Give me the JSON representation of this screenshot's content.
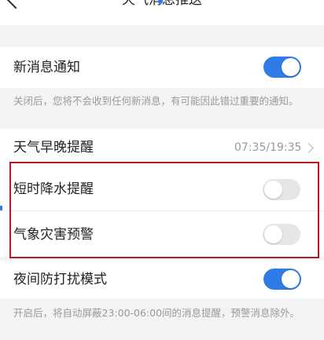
{
  "header": {
    "title": "天气消息推送"
  },
  "settings": {
    "new_message": {
      "label": "新消息通知",
      "enabled": true,
      "description": "关闭后，您将不会收到任何新消息，有可能因此错过重要的通知。"
    },
    "morning_evening": {
      "label": "天气早晚提醒",
      "value": "07:35/19:35"
    },
    "short_rain": {
      "label": "短时降水提醒",
      "enabled": false
    },
    "disaster_warning": {
      "label": "气象灾害预警",
      "enabled": false
    },
    "night_dnd": {
      "label": "夜间防打扰模式",
      "enabled": true,
      "description": "开启后，将自动屏蔽23:00-06:00间的消息提醒，预警消息除外。"
    }
  },
  "colors": {
    "accent": "#2f7ce8",
    "toggle_off": "#e6e6e6",
    "highlight": "#b31d22"
  }
}
